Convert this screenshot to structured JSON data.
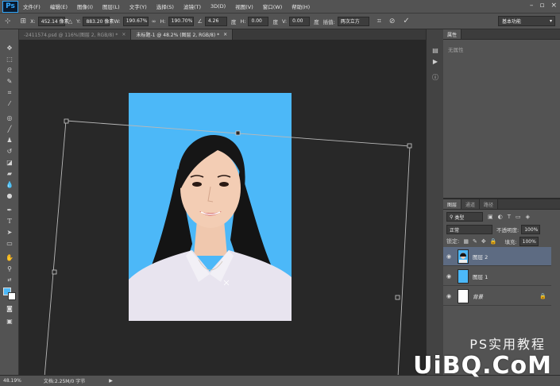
{
  "app": {
    "logo": "Ps"
  },
  "menu": [
    "文件(F)",
    "编辑(E)",
    "图像(I)",
    "图层(L)",
    "文字(Y)",
    "选择(S)",
    "滤镜(T)",
    "3D(D)",
    "视图(V)",
    "窗口(W)",
    "帮助(H)"
  ],
  "options": {
    "x_label": "X:",
    "x_value": "452.14 像素",
    "y_label": "Y:",
    "y_value": "883.20 像素",
    "w_label": "W:",
    "w_value": "190.67%",
    "h_label": "H:",
    "h_value": "190.70%",
    "angle_value": "4.26",
    "angle_unit": "度",
    "hskew_label": "H:",
    "hskew_value": "0.00",
    "hskew_unit": "度",
    "vskew_label": "V:",
    "vskew_value": "0.00",
    "vskew_unit": "度",
    "interp_label": "插值:",
    "interp_value": "两次立方",
    "workspace": "基本功能"
  },
  "tabs": [
    {
      "label": "-2411574.psd @ 116%(图层 2, RGB/8) *",
      "active": false
    },
    {
      "label": "未标题-1 @ 48.2% (图层 2, RGB/8) *",
      "active": true
    }
  ],
  "properties": {
    "tab": "属性",
    "empty": "无属性"
  },
  "layers_panel": {
    "tabs": [
      "图层",
      "通道",
      "路径"
    ],
    "filter": "类型",
    "blend": "正常",
    "opacity_label": "不透明度:",
    "opacity_value": "100%",
    "lock_label": "锁定:",
    "fill_label": "填充:",
    "fill_value": "100%",
    "items": [
      {
        "name": "图层 2",
        "selected": true
      },
      {
        "name": "图层 1",
        "selected": false
      },
      {
        "name": "背景",
        "selected": false
      }
    ]
  },
  "status": {
    "zoom": "48.19%",
    "doc": "文档:2.25M/0 字节"
  },
  "watermark": {
    "cn": "PS实用教程",
    "en": "UiBQ.CoM"
  },
  "colors": {
    "photo_bg": "#4cb8f8",
    "selected_layer": "#5d6b82",
    "layer1_fill": "#4cb8f8"
  }
}
